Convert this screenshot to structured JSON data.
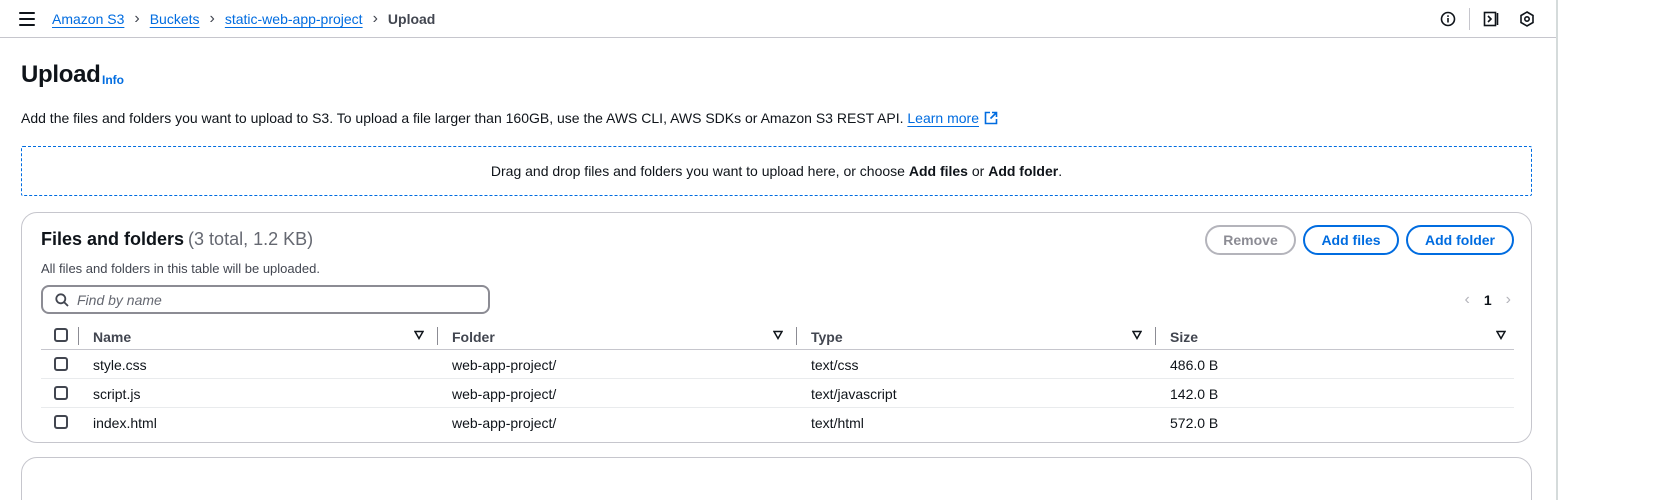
{
  "breadcrumb": {
    "items": [
      {
        "label": "Amazon S3"
      },
      {
        "label": "Buckets"
      },
      {
        "label": "static-web-app-project"
      }
    ],
    "current": "Upload"
  },
  "page": {
    "title": "Upload",
    "info_label": "Info",
    "description": "Add the files and folders you want to upload to S3. To upload a file larger than 160GB, use the AWS CLI, AWS SDKs or Amazon S3 REST API.",
    "learn_more": "Learn more"
  },
  "dropzone": {
    "text_before": "Drag and drop files and folders you want to upload here, or choose ",
    "add_files": "Add files",
    "or": " or ",
    "add_folder": "Add folder",
    "period": "."
  },
  "files_panel": {
    "title": "Files and folders",
    "count": "(3 total, 1.2 KB)",
    "subtitle": "All files and folders in this table will be uploaded.",
    "remove_label": "Remove",
    "add_files_label": "Add files",
    "add_folder_label": "Add folder",
    "search_placeholder": "Find by name",
    "page_number": "1",
    "columns": [
      "Name",
      "Folder",
      "Type",
      "Size"
    ],
    "rows": [
      {
        "name": "style.css",
        "folder": "web-app-project/",
        "type": "text/css",
        "size": "486.0 B"
      },
      {
        "name": "script.js",
        "folder": "web-app-project/",
        "type": "text/javascript",
        "size": "142.0 B"
      },
      {
        "name": "index.html",
        "folder": "web-app-project/",
        "type": "text/html",
        "size": "572.0 B"
      }
    ]
  },
  "colors": {
    "link": "#006ce0",
    "text": "#0f141a",
    "border": "#c6c6cd"
  },
  "icons": [
    "menu-icon",
    "info-circle-icon",
    "notifications-icon",
    "settings-icon",
    "external-link-icon",
    "search-icon",
    "chevron-left-icon",
    "chevron-right-icon",
    "sort-icon"
  ]
}
